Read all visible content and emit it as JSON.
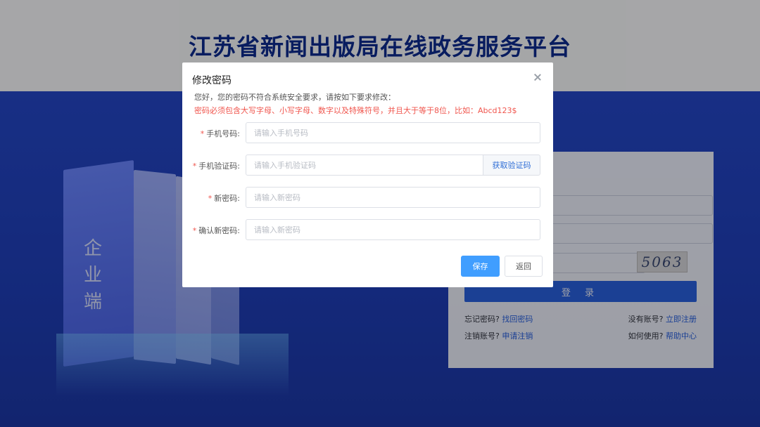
{
  "site": {
    "title": "江苏省新闻出版局在线政务服务平台",
    "side_label": "企业端"
  },
  "login": {
    "captcha": "5063",
    "login_label": "登 录",
    "forgot_prompt": "忘记密码?",
    "forgot_link": "找回密码",
    "register_prompt": "没有账号?",
    "register_link": "立即注册",
    "cancel_prompt": "注销账号?",
    "cancel_link": "申请注销",
    "help_prompt": "如何使用?",
    "help_link": "帮助中心"
  },
  "dialog": {
    "title": "修改密码",
    "notice": "您好，您的密码不符合系统安全要求，请按如下要求修改：",
    "warning": "密码必须包含大写字母、小写字母、数字以及特殊符号，并且大于等于8位，比如：Abcd123$",
    "required_mark": "*",
    "fields": {
      "phone": {
        "label": "手机号码:",
        "placeholder": "请输入手机号码"
      },
      "sms_code": {
        "label": "手机验证码:",
        "placeholder": "请输入手机验证码"
      },
      "new_password": {
        "label": "新密码:",
        "placeholder": "请输入新密码"
      },
      "confirm_password": {
        "label": "确认新密码:",
        "placeholder": "请输入新密码"
      }
    },
    "get_code_label": "获取验证码",
    "save_label": "保存",
    "back_label": "返回"
  }
}
